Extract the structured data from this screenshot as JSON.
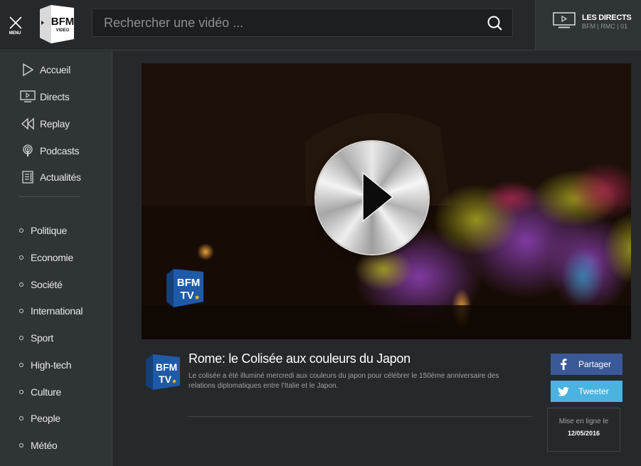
{
  "header": {
    "menu_label": "MENU",
    "logo_text": "BFM",
    "logo_subtext": "VIDEO",
    "search_placeholder": "Rechercher une vidéo ...",
    "search_value": "",
    "live": {
      "title": "LES DIRECTS",
      "subtitle": "BFM | RMC | 01"
    }
  },
  "sidebar": {
    "main_items": [
      {
        "label": "Accueil",
        "icon": "play-outline-icon"
      },
      {
        "label": "Directs",
        "icon": "tv-icon"
      },
      {
        "label": "Replay",
        "icon": "rewind-icon"
      },
      {
        "label": "Podcasts",
        "icon": "podcast-icon"
      },
      {
        "label": "Actualités",
        "icon": "news-icon"
      }
    ],
    "categories": [
      {
        "label": "Politique"
      },
      {
        "label": "Economie"
      },
      {
        "label": "Société"
      },
      {
        "label": "International"
      },
      {
        "label": "Sport"
      },
      {
        "label": "High-tech"
      },
      {
        "label": "Culture"
      },
      {
        "label": "People"
      },
      {
        "label": "Météo"
      }
    ]
  },
  "video": {
    "watermark_line1": "BFM",
    "watermark_line2": "TV"
  },
  "article": {
    "channel_logo_line1": "BFM",
    "channel_logo_line2": "TV",
    "title": "Rome: le Colisée aux couleurs du Japon",
    "description": "Le colisée a été illuminé mercredi aux couleurs du japon pour célébrer le 150ème anniversaire des relations diplomatiques entre l'Italie et le Japon."
  },
  "share": {
    "facebook_label": "Partager",
    "twitter_label": "Tweeter"
  },
  "publication": {
    "label": "Mise en ligne le",
    "date": "12/05/2016"
  },
  "colors": {
    "facebook": "#3b5998",
    "twitter": "#4ab3e0",
    "brand_blue": "#1e5aa8"
  }
}
